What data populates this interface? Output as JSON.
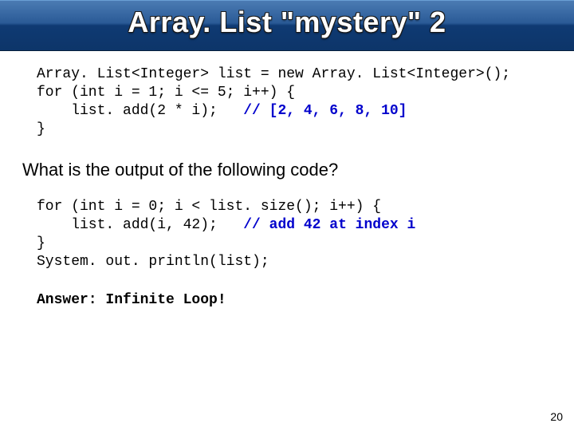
{
  "title": "Array. List \"mystery\" 2",
  "code1": {
    "line1a": "Array. List<Integer> list = new Array. List<Integer>();",
    "line2a": "for (int i = 1; i <= 5; i++) {",
    "line3a": "    list. add(2 * i);",
    "line3b": "   // [2, 4, 6, 8, 10]",
    "line4a": "}"
  },
  "question": "What is the output of the following code?",
  "code2": {
    "line1a": "for (int i = 0; i < list. size(); i++) {",
    "line2a": "    list. add(i, 42);",
    "line2b": "   // add 42 at index i",
    "line3a": "}",
    "line4a": "System. out. println(list);"
  },
  "answer": "Answer: Infinite Loop!",
  "page_number": "20"
}
